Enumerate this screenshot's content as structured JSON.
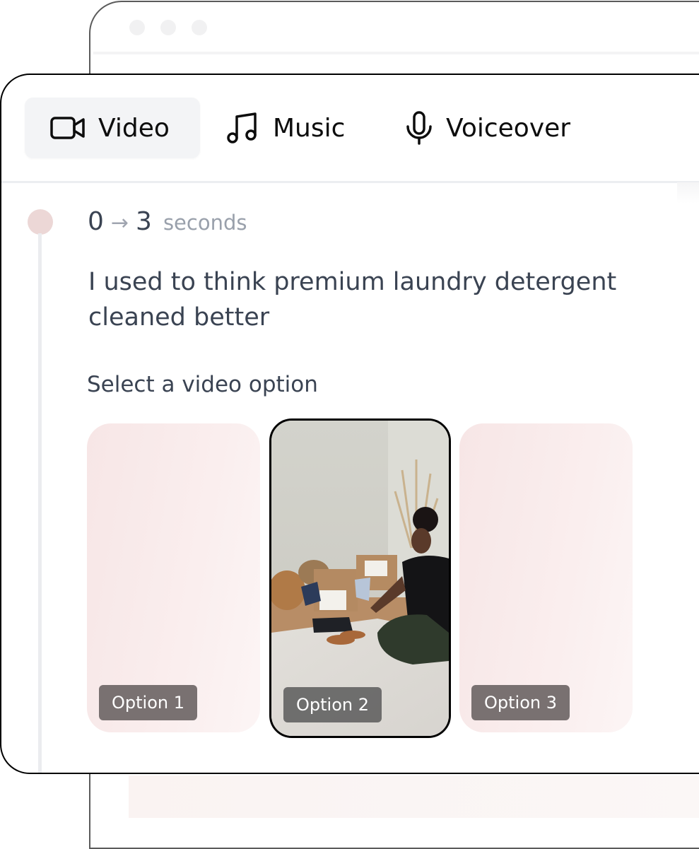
{
  "tabs": [
    {
      "label": "Video",
      "icon": "video-camera-icon",
      "active": true
    },
    {
      "label": "Music",
      "icon": "music-note-icon",
      "active": false
    },
    {
      "label": "Voiceover",
      "icon": "microphone-icon",
      "active": false
    }
  ],
  "segment": {
    "start": "0",
    "arrow": "→",
    "end": "3",
    "unit": "seconds",
    "script": "I used to think premium laundry detergent cleaned better"
  },
  "video_options": {
    "label": "Select a video option",
    "selected": "Option 2",
    "options": [
      {
        "label": "Option 1"
      },
      {
        "label": "Option 2"
      },
      {
        "label": "Option 3"
      }
    ]
  },
  "colors": {
    "timeline_dot": "#ecd7d6",
    "card_tint": "#f7e6e6",
    "text_primary": "#3a4352",
    "text_muted": "#99a0ab"
  }
}
